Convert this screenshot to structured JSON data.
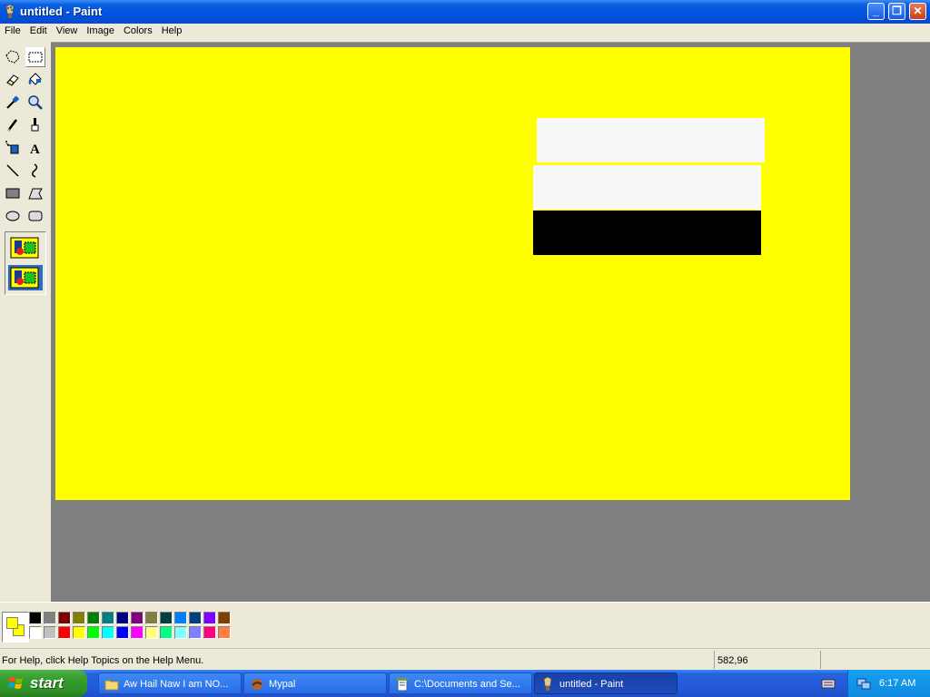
{
  "window": {
    "title": "untitled - Paint",
    "buttons": {
      "minimize": "_",
      "restore": "❐",
      "close": "✕"
    }
  },
  "menu": [
    "File",
    "Edit",
    "View",
    "Image",
    "Colors",
    "Help"
  ],
  "tools": [
    "free-form-select-icon",
    "select-icon",
    "eraser-icon",
    "fill-with-color-icon",
    "pick-color-icon",
    "magnifier-icon",
    "pencil-icon",
    "brush-icon",
    "airbrush-icon",
    "text-icon",
    "line-icon",
    "curve-icon",
    "rectangle-icon",
    "polygon-icon",
    "ellipse-icon",
    "rounded-rectangle-icon"
  ],
  "text_tool_glyph": "A",
  "selected_tool": "select-icon",
  "canvas": {
    "background": "#ffff00",
    "shapes": [
      {
        "name": "white-rectangle-top",
        "color": "#f7f7f7"
      },
      {
        "name": "white-rectangle-middle",
        "color": "#f7f7f7"
      },
      {
        "name": "black-rectangle-bottom",
        "color": "#000000"
      }
    ]
  },
  "current_colors": {
    "foreground": "#ffff00",
    "background": "#ffff00"
  },
  "palette_top": [
    "#000000",
    "#808080",
    "#800000",
    "#808000",
    "#008000",
    "#008080",
    "#000080",
    "#800080",
    "#808040",
    "#004040",
    "#0080ff",
    "#004080",
    "#8000ff",
    "#804000"
  ],
  "palette_bottom": [
    "#ffffff",
    "#c0c0c0",
    "#ff0000",
    "#ffff00",
    "#00ff00",
    "#00ffff",
    "#0000ff",
    "#ff00ff",
    "#ffff80",
    "#00ff80",
    "#80ffff",
    "#8080ff",
    "#ff0080",
    "#ff8040"
  ],
  "status": {
    "help": "For Help, click Help Topics on the Help Menu.",
    "coords": "582,96",
    "size": ""
  },
  "taskbar": {
    "start_label": "start",
    "tasks": [
      {
        "label": "Aw Hail Naw I am NO...",
        "icon": "folder-icon",
        "active": false
      },
      {
        "label": "Mypal",
        "icon": "browser-icon",
        "active": false
      },
      {
        "label": "C:\\Documents and Se...",
        "icon": "notepad-icon",
        "active": false
      },
      {
        "label": "untitled - Paint",
        "icon": "paint-icon",
        "active": true
      }
    ],
    "clock": "6:17 AM"
  }
}
